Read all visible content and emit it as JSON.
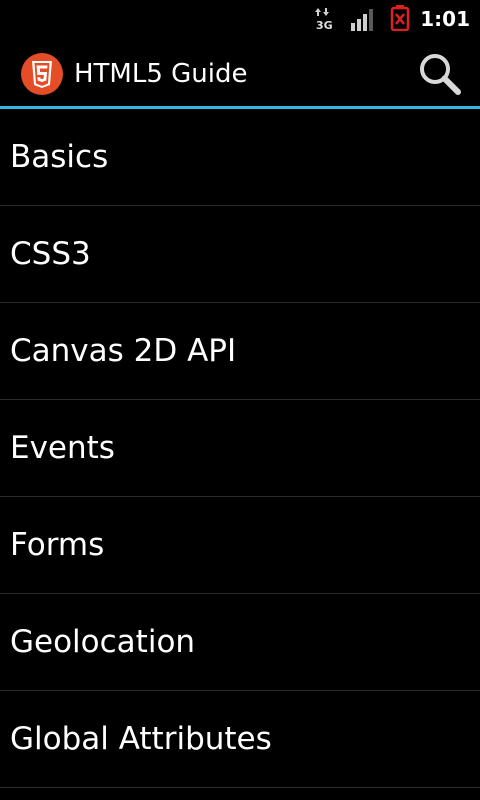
{
  "status_bar": {
    "network_label": "3G",
    "network_icon": "3g-data-icon",
    "signal_icon": "signal-strength-icon",
    "battery_icon": "battery-empty-icon",
    "time": "1:01"
  },
  "action_bar": {
    "app_icon": "html5-logo-icon",
    "logo_text": "5",
    "title": "HTML5 Guide",
    "search_icon": "search-icon",
    "accent_color": "#33b5e5"
  },
  "topics": [
    {
      "label": "Basics"
    },
    {
      "label": "CSS3"
    },
    {
      "label": "Canvas 2D API"
    },
    {
      "label": "Events"
    },
    {
      "label": "Forms"
    },
    {
      "label": "Geolocation"
    },
    {
      "label": "Global Attributes"
    }
  ]
}
